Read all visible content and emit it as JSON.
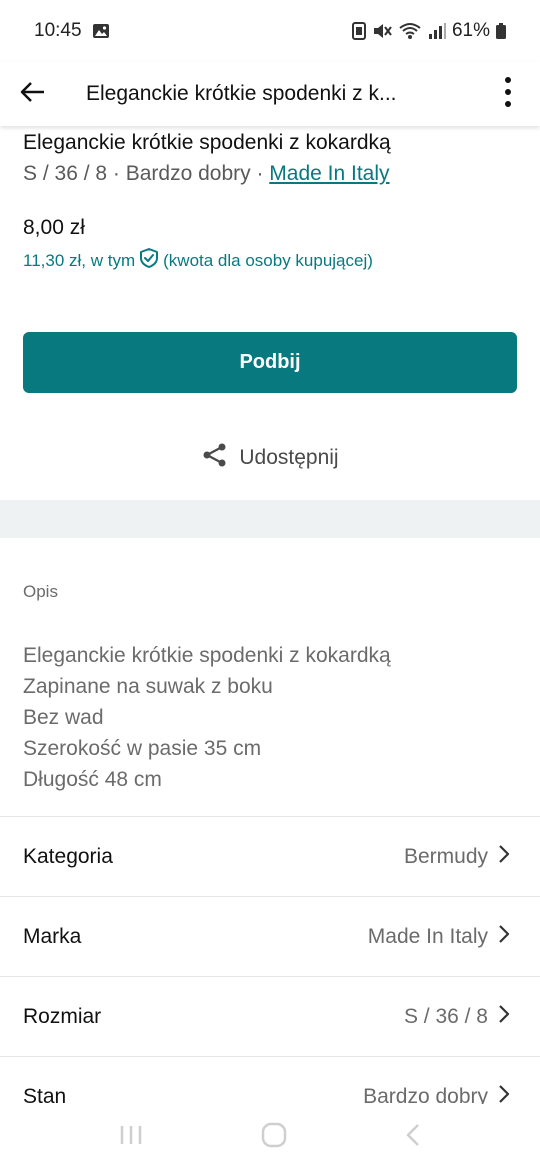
{
  "status": {
    "time": "10:45",
    "battery": "61%"
  },
  "app_bar": {
    "title": "Eleganckie krótkie spodenki z k..."
  },
  "item": {
    "title": "Eleganckie krótkie spodenki z kokardką",
    "size_condition": "S / 36 / 8 · Bardzo dobry · ",
    "brand_link": "Made In Italy",
    "price": "8,00 zł",
    "buyer_price_prefix": "11,30 zł, w tym",
    "buyer_price_suffix": "(kwota dla osoby kupującej)"
  },
  "actions": {
    "primary_label": "Podbij",
    "share_label": "Udostępnij"
  },
  "description": {
    "label": "Opis",
    "lines": [
      "Eleganckie krótkie spodenki z kokardką",
      "Zapinane na suwak z boku",
      "Bez wad",
      "Szerokość w pasie 35 cm",
      "Długość 48 cm"
    ]
  },
  "details": [
    {
      "label": "Kategoria",
      "value": "Bermudy"
    },
    {
      "label": "Marka",
      "value": "Made In Italy"
    },
    {
      "label": "Rozmiar",
      "value": "S / 36 / 8"
    },
    {
      "label": "Stan",
      "value": "Bardzo dobry"
    }
  ],
  "colors": {
    "accent": "#087a7f",
    "divider": "#eef2f2"
  }
}
